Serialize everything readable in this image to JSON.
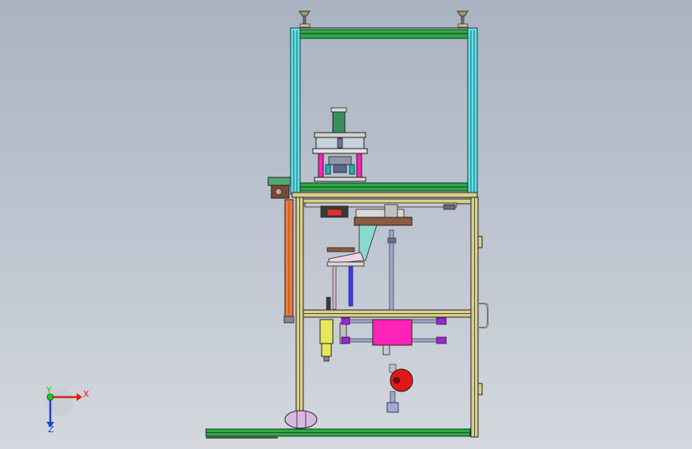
{
  "viewport": {
    "background_top": "#aab3c2",
    "background_bottom": "#d4d8de"
  },
  "triad": {
    "x_label": "X",
    "y_label": "Y",
    "z_label": "Z",
    "x_color": "#e0201c",
    "y_color": "#1fc21f",
    "z_color": "#1f3fd8"
  },
  "colors": {
    "frame_green": "#2ea84a",
    "frame_cyan": "#5fe0e8",
    "frame_tan": "#d8cf8a",
    "magenta": "#ff22b8",
    "orange_cylinder": "#f07a3a",
    "yellow_cylinder": "#e6e85a",
    "red_motor": "#e01818",
    "brown_plate": "#8a5a44"
  }
}
